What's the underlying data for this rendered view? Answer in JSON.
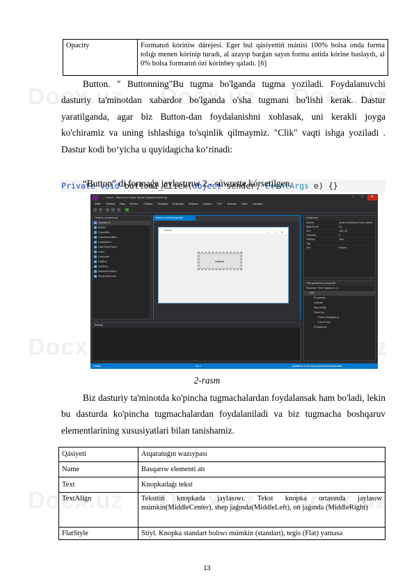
{
  "top_table": {
    "rows": [
      {
        "property": "Opacity",
        "description": "Formanıń kóriniw dárejesi. Eger bul qásiyettiń mánisi 100% bolsa onda forma tolıǵı menen kórinip turadı, al azayıp barǵan sayın forma astida kórine baslaydı, al 0% bolsa formanıń ózi kórinbey qaladı. [6]"
      }
    ]
  },
  "paragraph1": "Button. \" Buttonning\"Bu tugma bo'lganda tugma yoziladi. Foydalanuvchi dasturiy ta'minotdan xabardor bo'lganda o'sha tugmani bo'lishi kerak. Dastur yaratilganda, agar biz Button-dan foydalanishni xohlasak, uni kerakli joyga ko'chiramiz va uning ishlashiga to'sqinlik qilmaymiz. \"Clik\"  vaqti ishga yoziladi . Dastur kodi boʻyicha u quyidagicha koʻrinadi:",
  "code": {
    "kw1": "Private",
    "kw2": "void",
    "name": " button1_Click(",
    "kw3": "object",
    "p1": " sender, ",
    "type": "EventArgs",
    "p2": " e) {}"
  },
  "figure_intro": "“Button” di formaǵa jaylastırıw 2 - súwrette kórsetilgen.",
  "figure": {
    "caption": "2-rasm",
    "ide": {
      "title": "Form1 - Microsoft Visual Studio (Администратор)",
      "menu": [
        "Файл",
        "Правка",
        "Вид",
        "Проект",
        "Сборка",
        "Отладка",
        "Команда",
        "Формат",
        "Сервис",
        "Тест",
        "Анализ",
        "Окно",
        "Справка"
      ],
      "window_buttons": [
        "–",
        "□",
        "✕"
      ],
      "toolbox_header": "Панель элементов",
      "toolbox_items": [
        "Указатель",
        "Button",
        "CheckBox",
        "CheckedListBox",
        "ComboBox",
        "DateTimePicker",
        "Label",
        "LinkLabel",
        "ListBox",
        "ListView",
        "MaskedTextBox",
        "MonthCalendar"
      ],
      "designer_tab": "Form1.cs [Конструктор]",
      "form_title": "Form1",
      "form_controls": "—  □  ✕",
      "button_text": "button1",
      "output_header": "Вывод",
      "props_header": "Свойства",
      "props": [
        {
          "k": "button1",
          "v": "System.Windows.Forms.Button"
        },
        {
          "k": "RightToLeft",
          "v": "No"
        },
        {
          "k": "Size",
          "v": "150; 43"
        },
        {
          "k": "TabIndex",
          "v": "0"
        },
        {
          "k": "TabStop",
          "v": "True"
        },
        {
          "k": "Tag",
          "v": ""
        },
        {
          "k": "Text",
          "v": "button1"
        }
      ],
      "solution_header": "Обозреватель решений",
      "solution_items": [
        "Решение \"Test\" (проекты: 1)",
        "Test",
        "Properties",
        "Ссылки",
        "App.config",
        "Form1.cs",
        "Form1.Designer.cs",
        "Form1.resx",
        "Program.cs"
      ],
      "status_left": "Готово",
      "status_mid": "Стр 1",
      "status_right": "Добавить в систему управления версиями"
    }
  },
  "paragraph2": "Biz dasturiy ta'minotda ko'pincha tugmachalardan foydalansak ham bo'ladi, lekin bu dasturda ko'pincha tugmachalardan foydalaniladi va biz tugmacha boshqaruv elementlarining xususiyatlari bilan tanishamiz.",
  "bottom_table": {
    "header": {
      "property": "Qásiyeti",
      "description": "Atqaratuǵın wazıypası"
    },
    "rows": [
      {
        "property": "Name",
        "description": "Basqarıw elementi atı"
      },
      {
        "property": "Text",
        "description": "Knopkadaǵı tekst"
      },
      {
        "property": "TextAlign",
        "description": "Teksttiń knopkada jaylasıwı. Tekst knopka ortasında jaylasıw múmkin(MiddleCenter), shep jaǵında(MiddleLeft), oń jaǵında (MiddleRight)"
      },
      {
        "property": "FlatStyle",
        "description": "Stiyl. Knopka standart bolıwı múmkin (standart), tegis (Flat) yamasa"
      }
    ]
  },
  "page_number": "13",
  "watermark": "Docx.uz"
}
